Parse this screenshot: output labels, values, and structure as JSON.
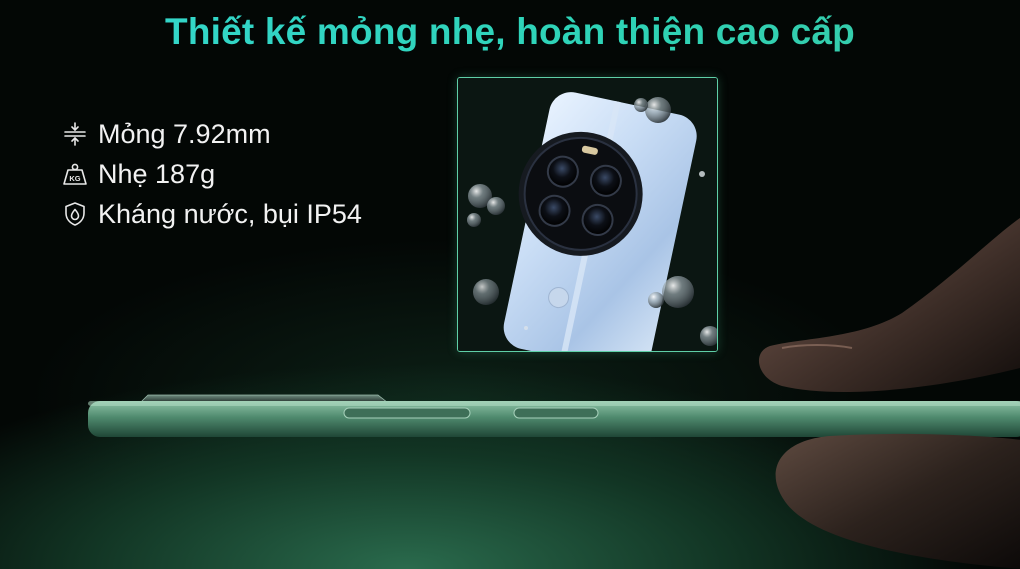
{
  "headline": "Thiết kế mỏng nhẹ, hoàn thiện cao cấp",
  "features": [
    {
      "icon": "thickness-icon",
      "text": "Mỏng 7.92mm"
    },
    {
      "icon": "weight-kg-icon",
      "text": "Nhẹ 187g"
    },
    {
      "icon": "water-shield-icon",
      "text": "Kháng nước, bụi IP54"
    }
  ],
  "weight_badge": "KG",
  "colors": {
    "headline": "#2fd8c4",
    "inset_border": "#5fcfa7",
    "phone_frame": "#4f8a6e",
    "background": "#030705"
  }
}
